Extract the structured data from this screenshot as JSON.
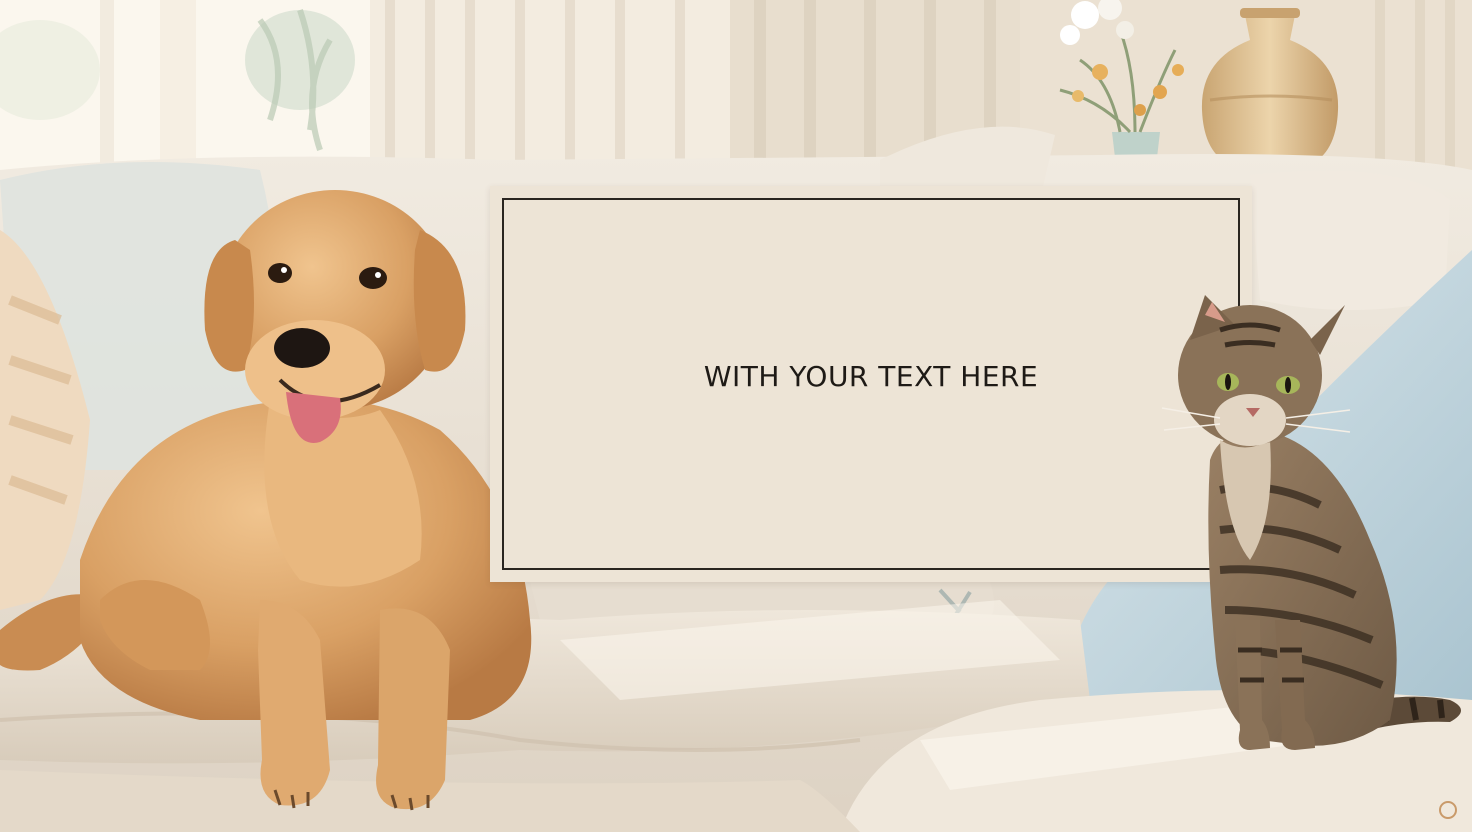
{
  "card": {
    "caption": "WITH YOUR TEXT HERE"
  },
  "palette": {
    "wall": "#efe6d8",
    "window_light": "#fbf7ee",
    "sofa": "#ece4d8",
    "sofa_shadow": "#d9cdbd",
    "card_fill": "#ede4d6",
    "card_border": "#2a2520",
    "dog_fur": "#d9a064",
    "cat_fur": "#8a7258",
    "pillow_blue": "#c7d8e0",
    "vase": "#d8b98e"
  },
  "illustration": {
    "subjects": [
      "golden-retriever",
      "tabby-cat",
      "sofa",
      "pillows",
      "window",
      "curtains",
      "flower-vase",
      "ceramic-vase"
    ]
  }
}
